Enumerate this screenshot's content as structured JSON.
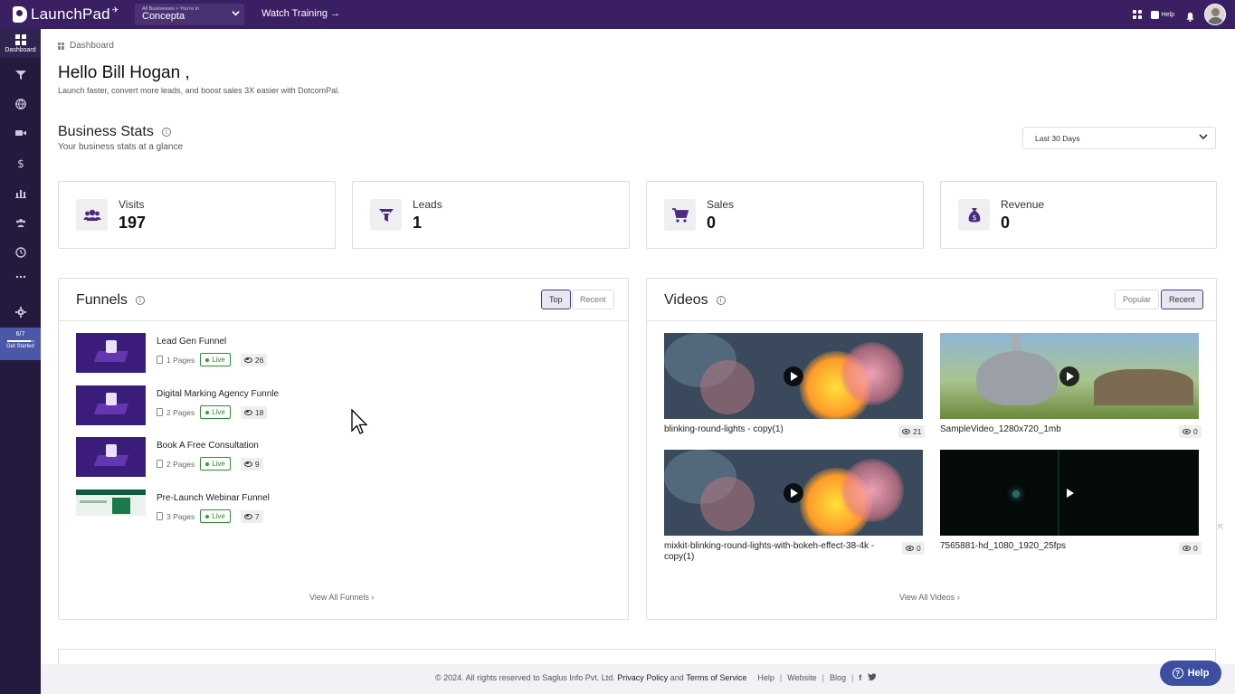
{
  "topbar": {
    "logo": "LaunchPad",
    "business_small": "All Businesses > You're in",
    "business_name": "Concepta",
    "watch_training": "Watch Training →",
    "help_label": "Help"
  },
  "sidebar": {
    "dashboard_label": "Dashboard",
    "getstarted_count": "6/7",
    "getstarted_label": "Get Started",
    "getstarted_progress": 0.857
  },
  "breadcrumb": "Dashboard",
  "greeting": "Hello Bill Hogan ,",
  "tagline": "Launch faster, convert more leads, and boost sales 3X easier with DotcomPal.",
  "business_stats": {
    "title": "Business Stats",
    "subtitle": "Your business stats at a glance",
    "range": "Last 30 Days",
    "cards": [
      {
        "label": "Visits",
        "value": "197",
        "icon": "users-icon"
      },
      {
        "label": "Leads",
        "value": "1",
        "icon": "funnel-icon"
      },
      {
        "label": "Sales",
        "value": "0",
        "icon": "cart-icon"
      },
      {
        "label": "Revenue",
        "value": "0",
        "icon": "money-bag-icon"
      }
    ]
  },
  "funnels": {
    "title": "Funnels",
    "toggle_top": "Top",
    "toggle_recent": "Recent",
    "items": [
      {
        "name": "Lead Gen Funnel",
        "pages": "1 Pages",
        "status": "Live",
        "views": "26"
      },
      {
        "name": "Digital Marking Agency Funnle",
        "pages": "2 Pages",
        "status": "Live",
        "views": "18"
      },
      {
        "name": "Book A Free Consultation",
        "pages": "2 Pages",
        "status": "Live",
        "views": "9"
      },
      {
        "name": "Pre-Launch Webinar Funnel",
        "pages": "3 Pages",
        "status": "Live",
        "views": "7"
      }
    ],
    "view_all": "View All Funnels ›"
  },
  "videos": {
    "title": "Videos",
    "toggle_popular": "Popular",
    "toggle_recent": "Recent",
    "items": [
      {
        "title": "blinking-round-lights - copy(1)",
        "views": "21"
      },
      {
        "title": "SampleVideo_1280x720_1mb",
        "views": "0"
      },
      {
        "title": "mixkit-blinking-round-lights-with-bokeh-effect-38-4k - copy(1)",
        "views": "0"
      },
      {
        "title": "7565881-hd_1080_1920_25fps",
        "views": "0"
      }
    ],
    "view_all": "View All Videos ›"
  },
  "footer": {
    "copyright": "©  2024. All rights reserved to Saglus Info Pvt. Ltd.",
    "privacy": "Privacy Policy",
    "and": "and",
    "terms": "Terms of Service",
    "help": "Help",
    "website": "Website",
    "blog": "Blog",
    "sep": "|",
    "facebook": "f",
    "twitter": "t"
  },
  "help_button": "Help"
}
